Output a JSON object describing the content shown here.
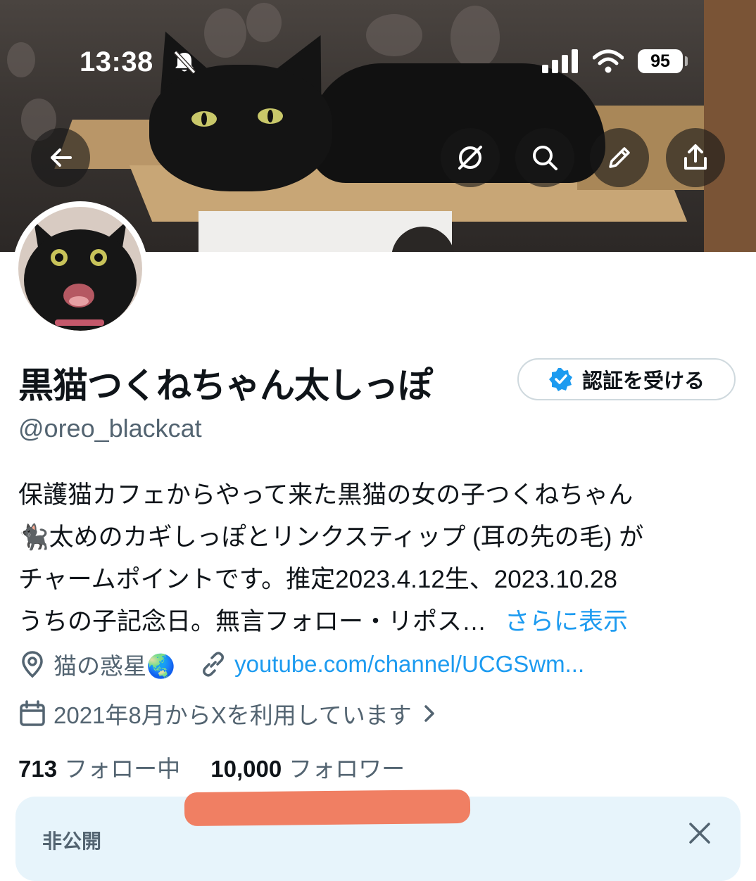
{
  "status_bar": {
    "time": "13:38",
    "battery": "95",
    "icons": [
      "bell-slash-icon",
      "signal-bars-icon",
      "wifi-icon",
      "battery-icon"
    ]
  },
  "banner_actions": {
    "back_icon": "arrow-left-icon",
    "icons": [
      "grok-icon",
      "search-icon",
      "pencil-icon",
      "share-icon"
    ]
  },
  "profile": {
    "display_name": "黒猫つくねちゃん太しっぽ",
    "verify_button": "認証を受ける",
    "handle": "@oreo_blackcat",
    "bio_lines": [
      "保護猫カフェからやって来た黒猫の女の子つくねちゃん",
      "🐈‍⬛太めのカギしっぽとリンクスティップ (耳の先の毛) が",
      "チャームポイントです。推定2023.4.12生、2023.10.28",
      "うちの子記念日。無言フォロー・リポス…"
    ],
    "show_more": "さらに表示",
    "location": "猫の惑星🌏",
    "website": "youtube.com/channel/UCGSwm...",
    "joined": "2021年8月からXを利用しています",
    "following_count": "713",
    "following_label": "フォロー中",
    "followers_count": "10,000",
    "followers_label": "フォロワー"
  },
  "notice": {
    "title": "非公開"
  },
  "colors": {
    "accent": "#1d9bf0",
    "secondary_text": "#536471",
    "redaction": "#f07f63",
    "notice_bg": "#e7f4fb"
  }
}
